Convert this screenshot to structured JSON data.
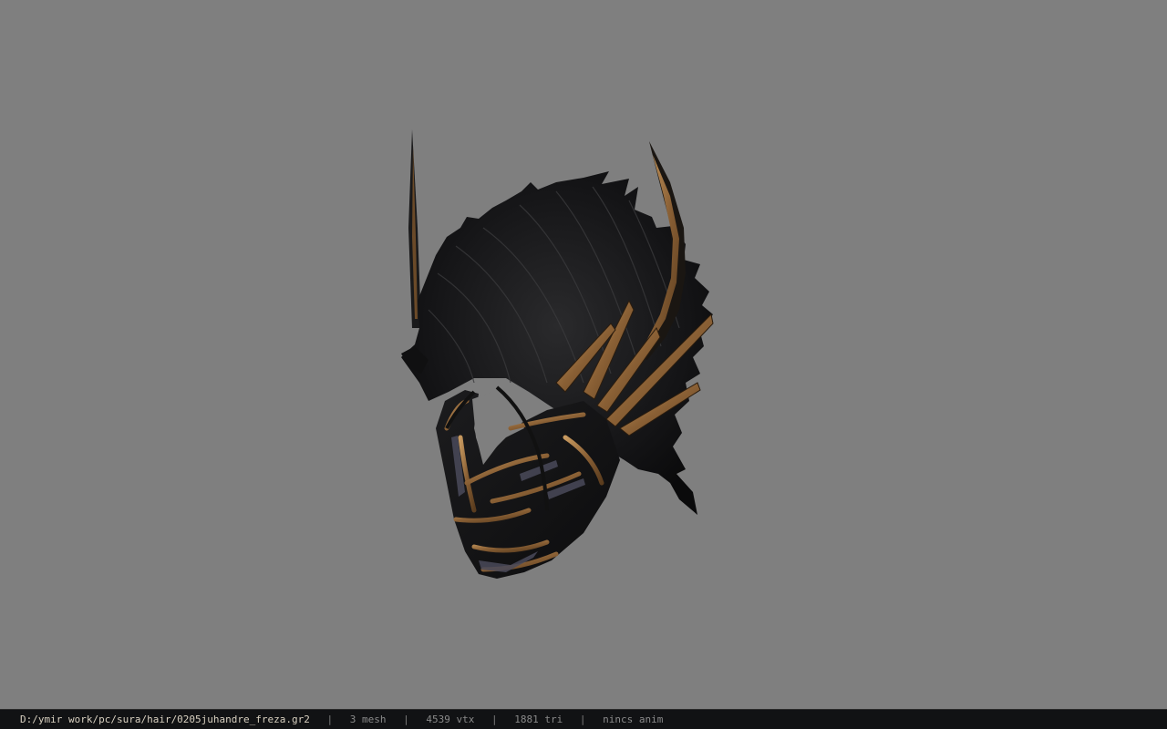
{
  "viewer": {
    "background_color": "#7f7f7f",
    "model_icon": "helmet-hair-mesh"
  },
  "statusbar": {
    "file_path": "D:/ymir work/pc/sura/hair/0205juhandre_freza.gr2",
    "separator": "|",
    "mesh_count": "3 mesh",
    "vertex_count": "4539 vtx",
    "triangle_count": "1881 tri",
    "animation_status": "nincs anim",
    "path_color": "#d8d0c0",
    "background_color": "#111214"
  }
}
